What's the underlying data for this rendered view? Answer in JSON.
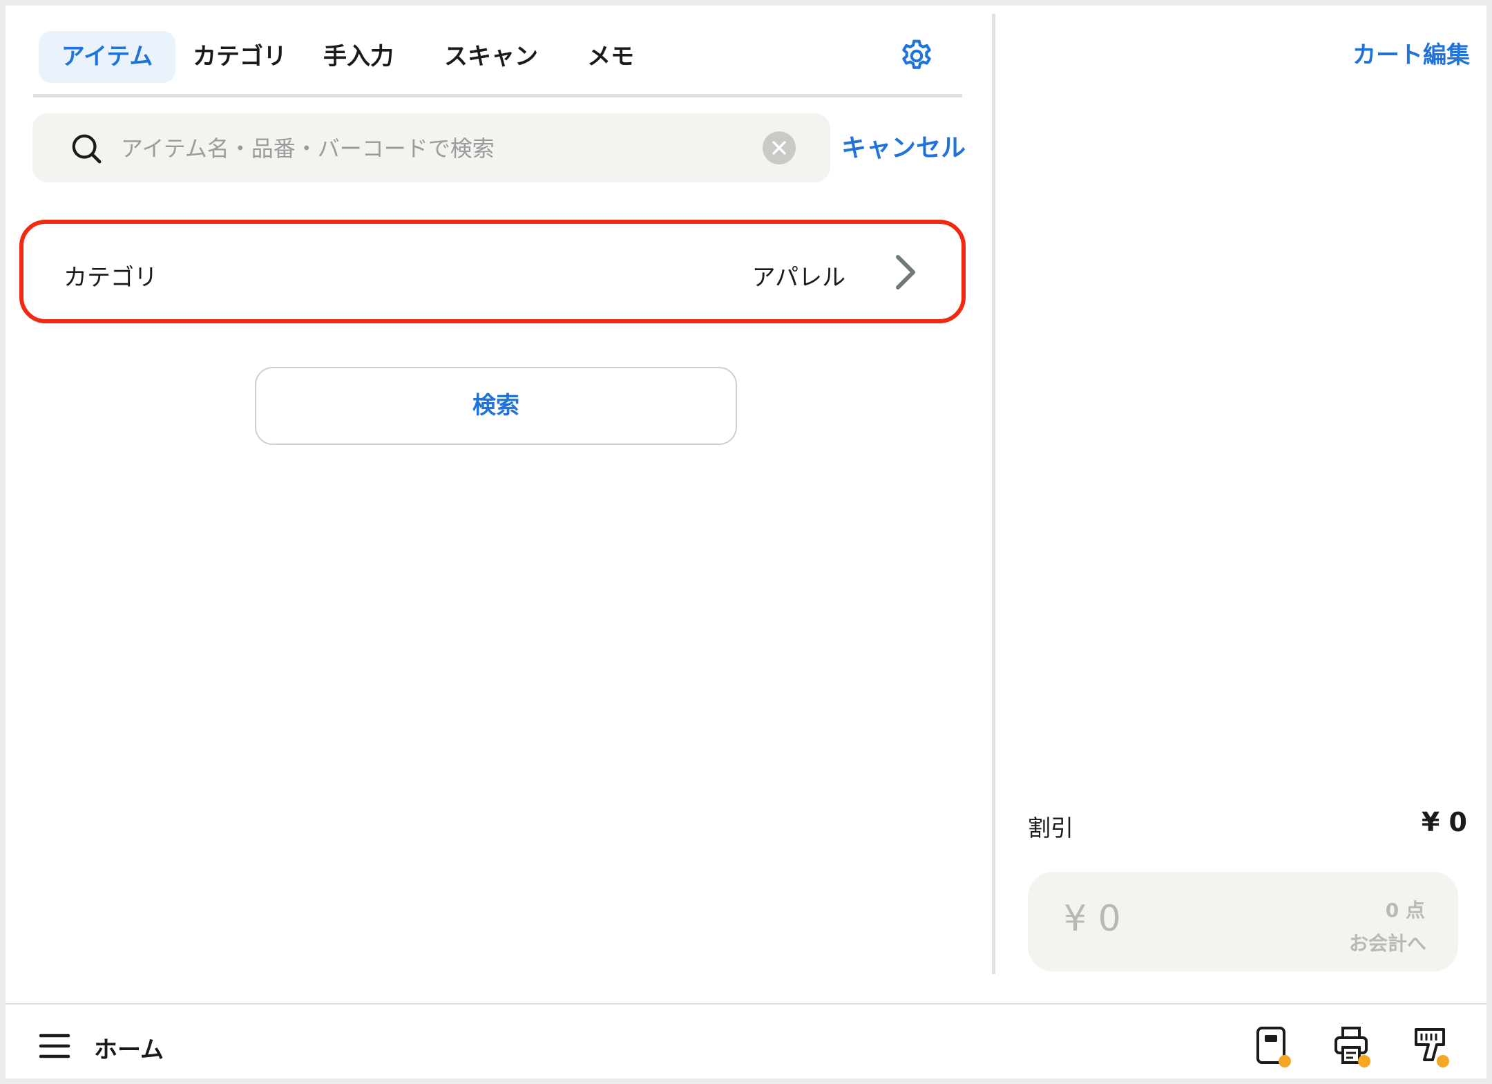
{
  "tabs": [
    {
      "label": "アイテム",
      "active": true
    },
    {
      "label": "カテゴリ",
      "active": false
    },
    {
      "label": "手入力",
      "active": false
    },
    {
      "label": "スキャン",
      "active": false
    },
    {
      "label": "メモ",
      "active": false
    }
  ],
  "search": {
    "placeholder": "アイテム名・品番・バーコードで検索",
    "value": "",
    "cancel_label": "キャンセル"
  },
  "filter": {
    "category_label": "カテゴリ",
    "category_value": "アパレル"
  },
  "search_button_label": "検索",
  "cart": {
    "edit_label": "カート編集",
    "discount_label": "割引",
    "discount_value": "¥ 0",
    "total_amount": "¥ 0",
    "item_count": "0 点",
    "checkout_label": "お会計へ"
  },
  "bottom_bar": {
    "home_label": "ホーム",
    "icons": [
      "card-reader-icon",
      "receipt-printer-icon",
      "barcode-scanner-icon"
    ]
  },
  "colors": {
    "accent": "#1f73d9",
    "highlight": "#f0290f",
    "status_dot": "#f5a623"
  }
}
